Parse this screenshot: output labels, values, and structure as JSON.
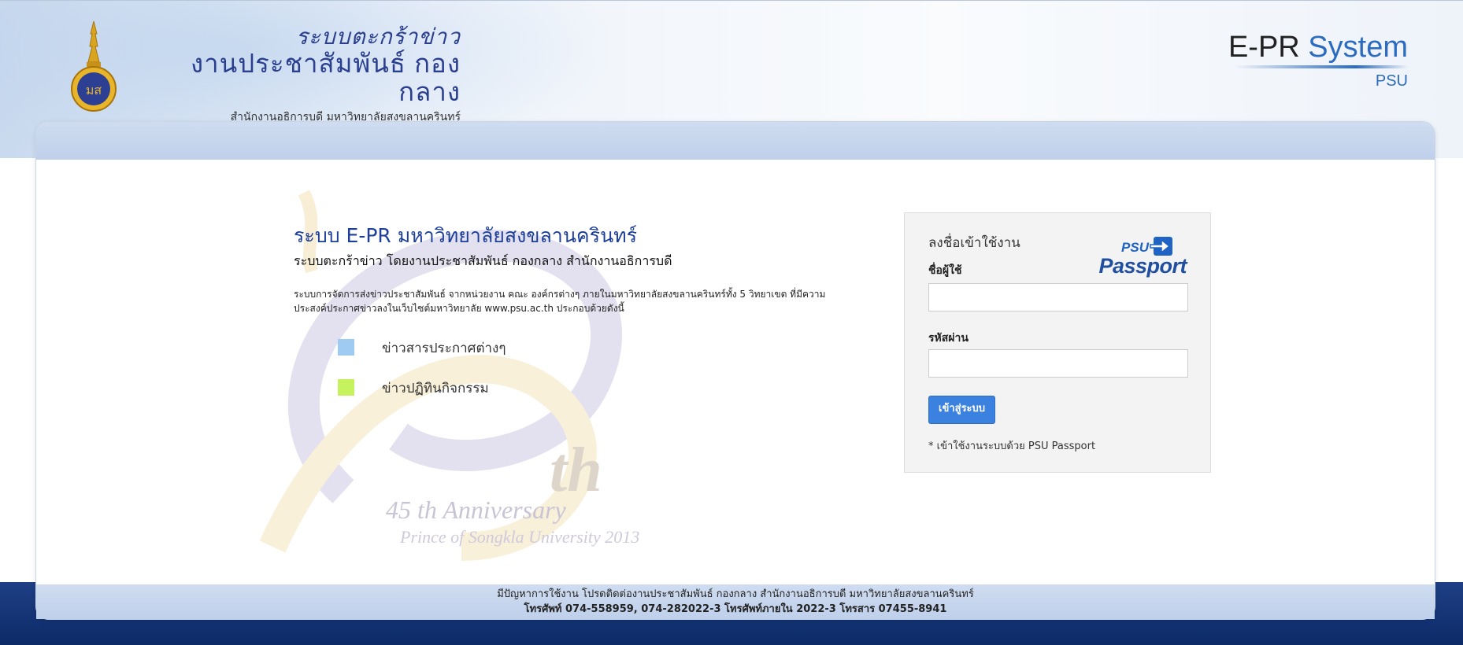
{
  "header": {
    "brand_line1": "ระบบตะกร้าข่าว",
    "brand_line2": "งานประชาสัมพันธ์ กองกลาง",
    "brand_line3": "สำนักงานอธิการบดี มหาวิทยาลัยสงขลานครินทร์",
    "product_name_prefix": "E-PR",
    "product_name_suffix": "System",
    "product_sub": "PSU"
  },
  "watermark": {
    "number_suffix": "th",
    "line1": "45 th Anniversary",
    "line2": "Prince of Songkla University 2013"
  },
  "intro": {
    "title": "ระบบ E-PR มหาวิทยาลัยสงขลานครินทร์",
    "subtitle": "ระบบตะกร้าข่าว โดยงานประชาสัมพันธ์ กองกลาง สำนักงานอธิการบดี",
    "description": "ระบบการจัดการส่งข่าวประชาสัมพันธ์ จากหน่วยงาน คณะ องค์กรต่างๆ ภายในมหาวิทยาลัยสงขลานครินทร์ทั้ง 5 วิทยาเขต ที่มีความประสงค์ประกาศข่าวลงในเว็บไซต์มหาวิทยาลัย www.psu.ac.th ประกอบด้วยดังนี้",
    "legend": [
      {
        "label": "ข่าวสารประกาศต่างๆ",
        "color": "#9fcbf2"
      },
      {
        "label": "ข่าวปฏิทินกิจกรรม",
        "color": "#c6f25e"
      }
    ]
  },
  "login": {
    "heading": "ลงชื่อเข้าใช้งาน",
    "passport_brand": "PSU",
    "passport_word": "Passport",
    "username_label": "ชื่อผู้ใช้",
    "username_value": "",
    "password_label": "รหัสผ่าน",
    "password_value": "",
    "submit_label": "เข้าสู่ระบบ",
    "note": "* เข้าใช้งานระบบด้วย PSU Passport"
  },
  "footer": {
    "line1": "มีปัญหาการใช้งาน โปรดติดต่องานประชาสัมพันธ์ กองกลาง สำนักงานอธิการบดี มหาวิทยาลัยสงขลานครินทร์",
    "line2": "โทรศัพท์ 074-558959, 074-282022-3 โทรศัพท์ภายใน 2022-3 โทรสาร 07455-8941"
  },
  "colors": {
    "accent": "#2b6cc0",
    "title_blue": "#1d3f9a",
    "button_blue": "#3b82e0"
  }
}
